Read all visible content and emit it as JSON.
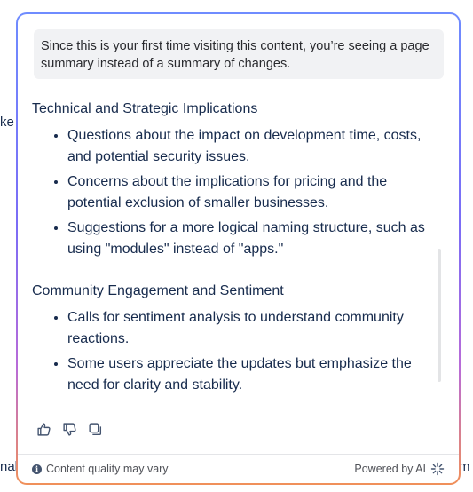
{
  "background": {
    "left_fragment_1": "ke",
    "left_fragment_2": "nak",
    "right_fragment": "m"
  },
  "notice": {
    "text": "Since this is your first time visiting this content, you’re seeing a page summary instead of a summary of changes."
  },
  "sections": [
    {
      "heading": "Technical and Strategic Implications",
      "bullets": [
        "Questions about the impact on development time, costs, and potential security issues.",
        "Concerns about the implications for pricing and the potential exclusion of smaller businesses.",
        "Suggestions for a more logical naming structure, such as using \"modules\" instead of \"apps.\""
      ]
    },
    {
      "heading": "Community Engagement and Sentiment",
      "bullets": [
        "Calls for sentiment analysis to understand community reactions.",
        "Some users appreciate the updates but emphasize the need for clarity and stability."
      ]
    }
  ],
  "actions": {
    "icons": [
      "thumbs-up-icon",
      "thumbs-down-icon",
      "copy-icon"
    ]
  },
  "footer": {
    "disclaimer": "Content quality may vary",
    "powered_by": "Powered by AI"
  },
  "colors": {
    "border_gradient": [
      "#6f8cff",
      "#7b6cf6",
      "#b86bd8",
      "#f0905a"
    ],
    "notice_bg": "#f1f2f4",
    "text": "#172b4d",
    "muted": "#505258"
  }
}
